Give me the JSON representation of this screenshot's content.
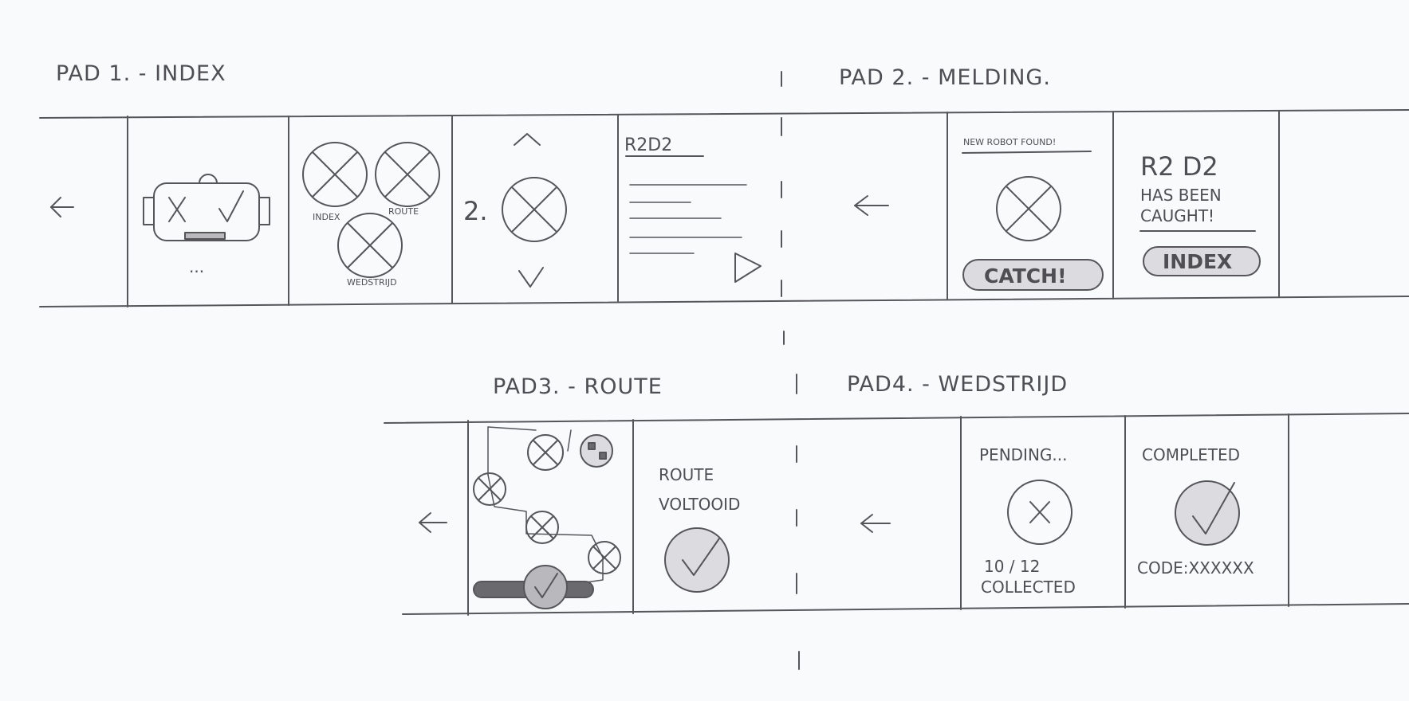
{
  "sections": {
    "pad1": "PAD 1. - INDEX",
    "pad2": "PAD 2. - MELDING.",
    "pad3": "PAD3. - ROUTE",
    "pad4": "PAD4. - WEDSTRIJD"
  },
  "pad1_frames": {
    "robot_dots": "...",
    "menu_index": "INDEX",
    "menu_route": "ROUTE",
    "menu_wedstrijd": "WEDSTRIJD",
    "step_number": "2.",
    "robot_name": "R2D2"
  },
  "pad2_frames": {
    "notification": "NEW ROBOT FOUND!",
    "catch_button": "CATCH!",
    "caught_name": "R2 D2",
    "caught_line1": "HAS BEEN",
    "caught_line2": "CAUGHT!",
    "index_button": "INDEX"
  },
  "pad3_frames": {
    "route_line1": "ROUTE",
    "route_line2": "VOLTOOID"
  },
  "pad4_frames": {
    "pending": "PENDING...",
    "collected_count": "10 / 12",
    "collected_label": "COLLECTED",
    "completed": "COMPLETED",
    "code": "CODE:XXXXXX"
  },
  "icons": [
    "arrow-left-icon",
    "robot-icon",
    "cross-circle-icon",
    "chevron-up-icon",
    "chevron-down-icon",
    "play-icon",
    "check-circle-icon",
    "route-map-icon"
  ]
}
